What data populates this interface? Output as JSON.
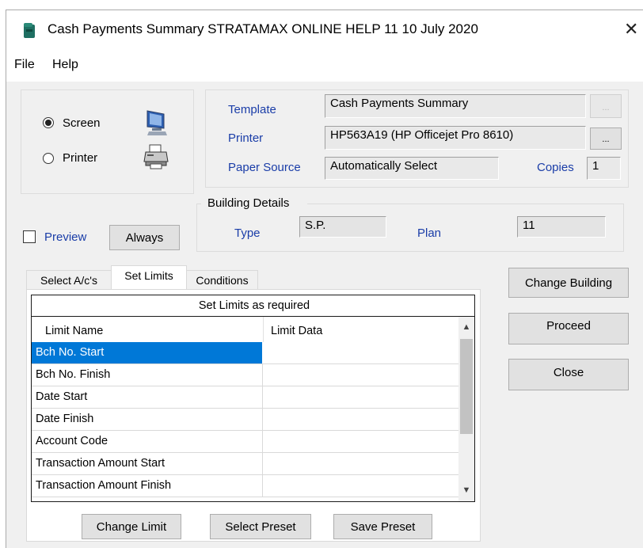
{
  "window": {
    "title": "Cash Payments Summary STRATAMAX ONLINE HELP 11 10 July 2020"
  },
  "menu": {
    "file": "File",
    "help": "Help"
  },
  "output": {
    "screen_label": "Screen",
    "printer_label": "Printer",
    "selected": "Screen"
  },
  "print_settings": {
    "template_label": "Template",
    "template_value": "Cash Payments Summary",
    "printer_label": "Printer",
    "printer_value": "HP563A19 (HP Officejet Pro 8610)",
    "browse_label": "...",
    "paper_source_label": "Paper Source",
    "paper_source_value": "Automatically Select",
    "copies_label": "Copies",
    "copies_value": "1"
  },
  "building_details": {
    "group_label": "Building Details",
    "type_label": "Type",
    "type_value": "S.P.",
    "plan_label": "Plan",
    "plan_value": "11"
  },
  "preview": {
    "label": "Preview",
    "checked": false,
    "always_label": "Always"
  },
  "tabs": [
    {
      "label": "Select A/c's",
      "active": false
    },
    {
      "label": "Set Limits",
      "active": true
    },
    {
      "label": "Conditions",
      "active": false
    }
  ],
  "limits": {
    "caption": "Set Limits as required",
    "columns": [
      "Limit Name",
      "Limit Data"
    ],
    "rows": [
      {
        "name": "Bch No. Start",
        "data": "",
        "selected": true
      },
      {
        "name": "Bch No. Finish",
        "data": ""
      },
      {
        "name": "Date Start",
        "data": ""
      },
      {
        "name": "Date Finish",
        "data": ""
      },
      {
        "name": "Account Code",
        "data": ""
      },
      {
        "name": "Transaction Amount Start",
        "data": ""
      },
      {
        "name": "Transaction Amount Finish",
        "data": ""
      }
    ]
  },
  "buttons": {
    "change_limit": "Change Limit",
    "select_preset": "Select Preset",
    "save_preset": "Save Preset",
    "change_building": "Change Building",
    "proceed": "Proceed",
    "close": "Close"
  },
  "colors": {
    "selection": "#0078d7",
    "label_blue": "#1a3da8",
    "window_bg": "#f0f0f0"
  },
  "icons": [
    "app-icon",
    "close-icon",
    "monitor-icon",
    "printer-icon",
    "scroll-up-icon",
    "scroll-down-icon"
  ]
}
